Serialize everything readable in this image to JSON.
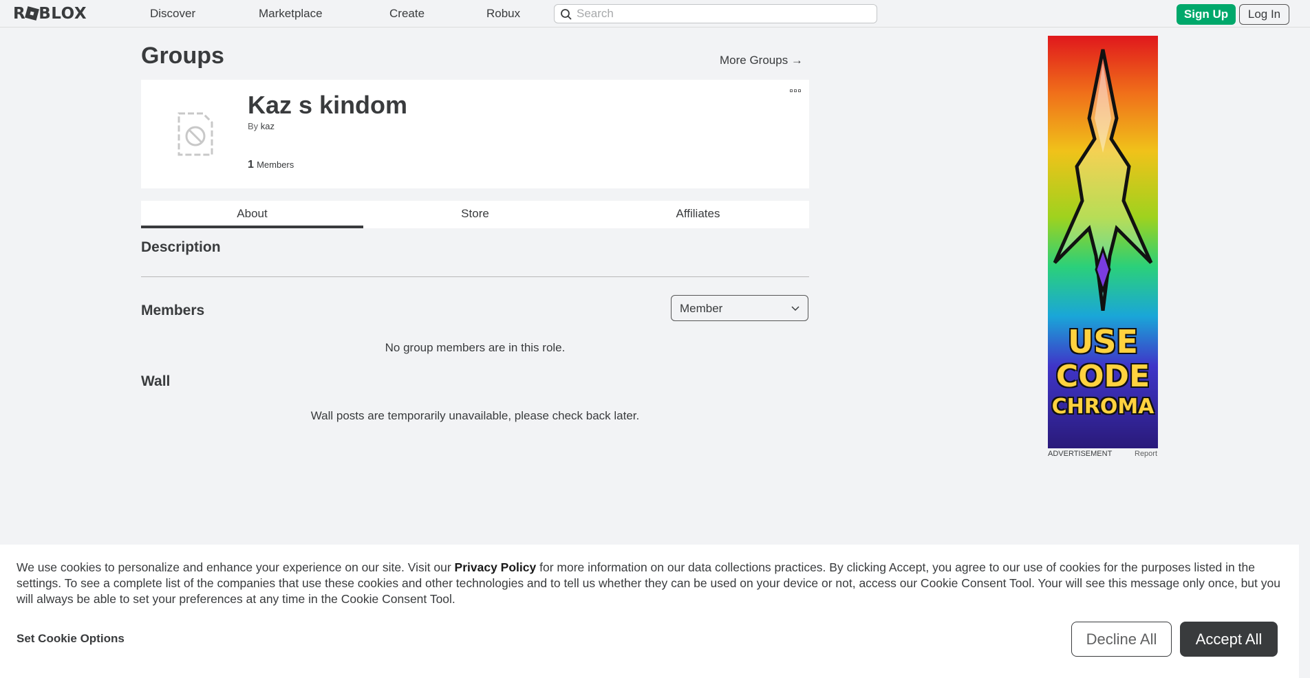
{
  "nav": {
    "links": [
      "Discover",
      "Marketplace",
      "Create",
      "Robux"
    ],
    "search_placeholder": "Search",
    "signup": "Sign Up",
    "login": "Log In"
  },
  "page": {
    "title": "Groups",
    "more_groups": "More Groups →"
  },
  "group": {
    "name": "Kaz s kindom",
    "by_label": "By",
    "owner": "kaz",
    "member_count": "1",
    "members_label": "Members"
  },
  "tabs": [
    "About",
    "Store",
    "Affiliates"
  ],
  "sections": {
    "description": "Description",
    "members": "Members",
    "role_selected": "Member",
    "members_empty": "No group members are in this role.",
    "wall": "Wall",
    "wall_empty": "Wall posts are temporarily unavailable, please check back later."
  },
  "ad": {
    "label": "ADVERTISEMENT",
    "report": "Report",
    "line1": "USE",
    "line2": "CODE",
    "line3": "CHROMA"
  },
  "cookie": {
    "text_1": "We use cookies to personalize and enhance your experience on our site. Visit our ",
    "privacy_policy": "Privacy Policy",
    "text_2": " for more information on our data collections practices. By clicking Accept, you agree to our use of cookies for the purposes listed in the settings. To see a complete list of the companies that use these cookies and other technologies and to tell us whether they can be used on your device or not, access our Cookie Consent Tool. Your will see this message only once, but you will always be able to set your preferences at any time in the Cookie Consent Tool.",
    "set_options": "Set Cookie Options",
    "decline": "Decline All",
    "accept": "Accept All"
  },
  "colors": {
    "signup_green": "#00a86b",
    "accept_dark": "#393b3d",
    "page_bg": "#f2f3f5"
  }
}
